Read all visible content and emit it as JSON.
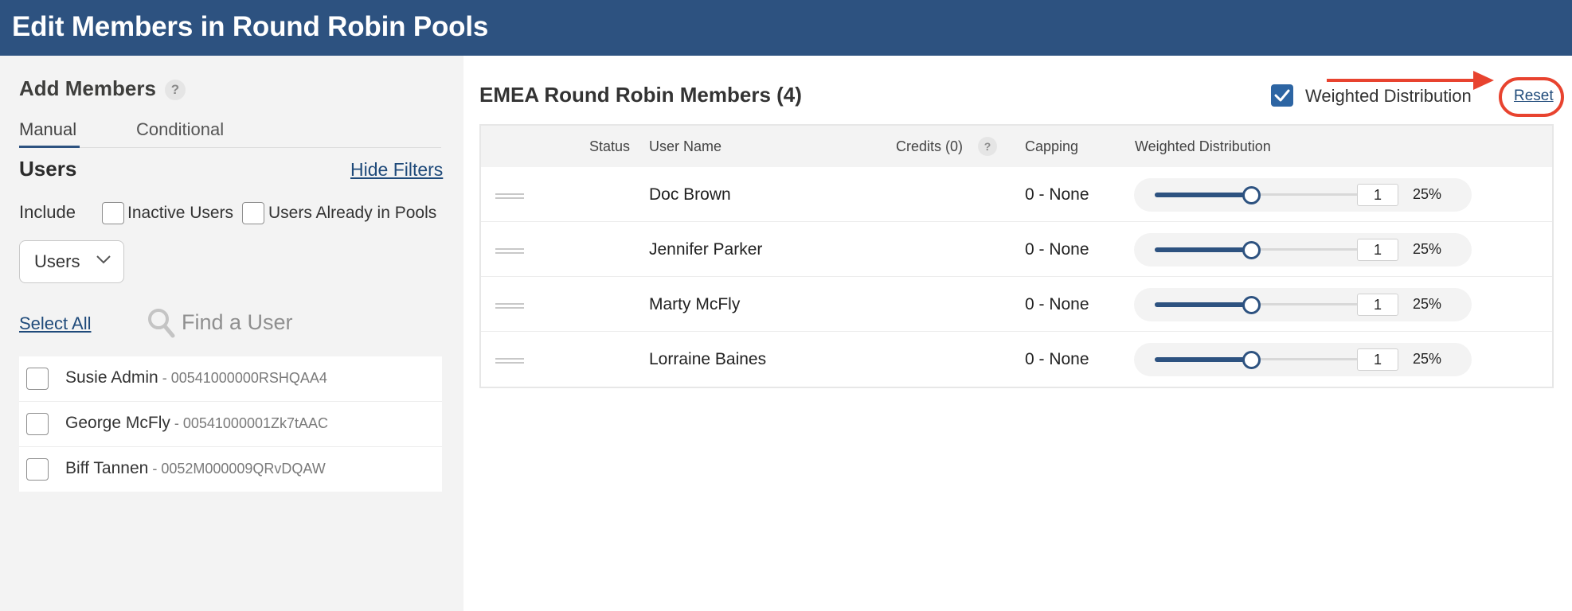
{
  "header": {
    "title": "Edit Members in Round Robin Pools"
  },
  "left_panel": {
    "add_members_title": "Add Members",
    "help_glyph": "?",
    "tabs": [
      {
        "label": "Manual",
        "active": true
      },
      {
        "label": "Conditional",
        "active": false
      }
    ],
    "users_heading": "Users",
    "hide_filters_label": "Hide Filters",
    "include_label": "Include",
    "filters": [
      {
        "label": "Inactive Users",
        "checked": false
      },
      {
        "label": "Users Already in Pools",
        "checked": false
      }
    ],
    "users_dropdown": {
      "selected": "Users",
      "icon": "chevron-down-icon"
    },
    "select_all_label": "Select All",
    "search": {
      "placeholder": "Find a User",
      "value": "",
      "icon": "search-icon"
    },
    "users": [
      {
        "name": "Susie Admin",
        "id": " - 00541000000RSHQAA4",
        "checked": false
      },
      {
        "name": "George McFly",
        "id": " - 00541000001Zk7tAAC",
        "checked": false
      },
      {
        "name": "Biff Tannen",
        "id": " - 0052M000009QRvDQAW",
        "checked": false
      }
    ]
  },
  "right_panel": {
    "pool_title": "EMEA Round Robin Members (4)",
    "weighted_distribution_toggle": {
      "label": "Weighted Distribution",
      "checked": true
    },
    "reset_label": "Reset",
    "annotation_color": "#e8432f",
    "table": {
      "columns": {
        "status": "Status",
        "user_name": "User Name",
        "credits": "Credits (0)",
        "capping": "Capping",
        "weighted_distribution": "Weighted Distribution"
      },
      "rows": [
        {
          "name": "Doc Brown",
          "capping": "0 - None",
          "weight": "1",
          "percent": "25%",
          "slider_fraction": 0.5
        },
        {
          "name": "Jennifer Parker",
          "capping": "0 - None",
          "weight": "1",
          "percent": "25%",
          "slider_fraction": 0.5
        },
        {
          "name": "Marty McFly",
          "capping": "0 - None",
          "weight": "1",
          "percent": "25%",
          "slider_fraction": 0.5
        },
        {
          "name": "Lorraine Baines",
          "capping": "0 - None",
          "weight": "1",
          "percent": "25%",
          "slider_fraction": 0.5
        }
      ]
    }
  },
  "colors": {
    "header_bg": "#2d5280",
    "accent": "#2d65a3",
    "link": "#1f4a7a",
    "left_panel_bg": "#f3f3f3"
  }
}
